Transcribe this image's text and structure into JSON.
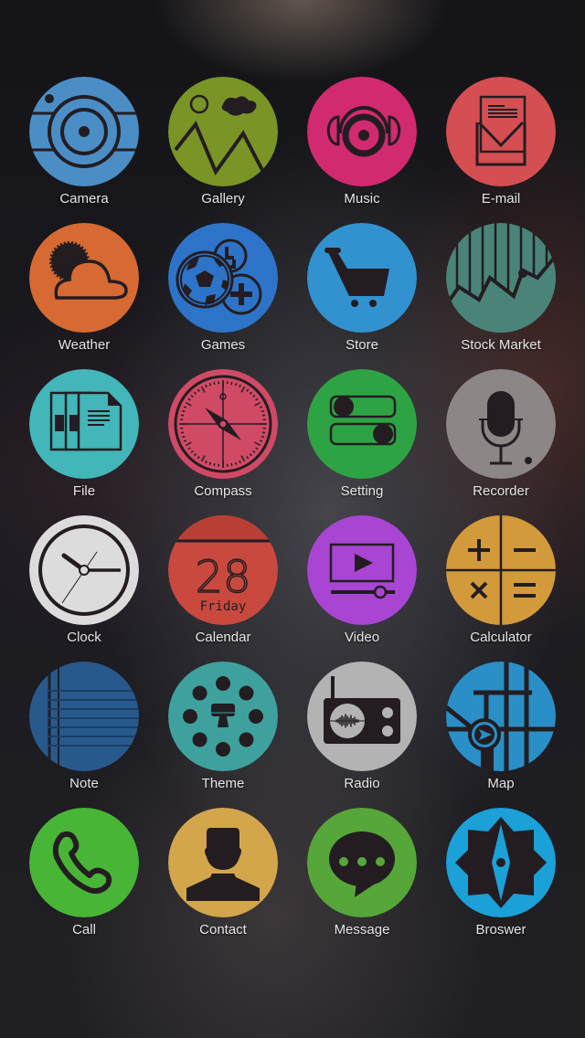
{
  "glyph_color": "#231d22",
  "apps": [
    {
      "label": "Camera",
      "icon": "camera-icon",
      "color": "#4b8ec6"
    },
    {
      "label": "Gallery",
      "icon": "gallery-icon",
      "color": "#7a9426"
    },
    {
      "label": "Music",
      "icon": "music-icon",
      "color": "#d22a6e"
    },
    {
      "label": "E-mail",
      "icon": "email-icon",
      "color": "#d44e52"
    },
    {
      "label": "Weather",
      "icon": "weather-icon",
      "color": "#d66a32"
    },
    {
      "label": "Games",
      "icon": "games-icon",
      "color": "#2d74c8"
    },
    {
      "label": "Store",
      "icon": "store-icon",
      "color": "#3292d0"
    },
    {
      "label": "Stock Market",
      "icon": "stock-market-icon",
      "color": "#4a8478"
    },
    {
      "label": "File",
      "icon": "file-icon",
      "color": "#42b6b8"
    },
    {
      "label": "Compass",
      "icon": "compass-icon",
      "color": "#d04a66"
    },
    {
      "label": "Setting",
      "icon": "setting-icon",
      "color": "#2ea343"
    },
    {
      "label": "Recorder",
      "icon": "recorder-icon",
      "color": "#8c8686"
    },
    {
      "label": "Clock",
      "icon": "clock-icon",
      "color": "#dcdcdc"
    },
    {
      "label": "Calendar",
      "icon": "calendar-icon",
      "color": "#c9493e",
      "day": "28",
      "weekday": "Friday"
    },
    {
      "label": "Video",
      "icon": "video-icon",
      "color": "#a845d2"
    },
    {
      "label": "Calculator",
      "icon": "calculator-icon",
      "color": "#d39a3c"
    },
    {
      "label": "Note",
      "icon": "note-icon",
      "color": "#28598c"
    },
    {
      "label": "Theme",
      "icon": "theme-icon",
      "color": "#3fa19e"
    },
    {
      "label": "Radio",
      "icon": "radio-icon",
      "color": "#b3b3b3"
    },
    {
      "label": "Map",
      "icon": "map-icon",
      "color": "#2a8fc6"
    },
    {
      "label": "Call",
      "icon": "phone-icon",
      "color": "#49b536"
    },
    {
      "label": "Contact",
      "icon": "contact-icon",
      "color": "#d3a64c"
    },
    {
      "label": "Message",
      "icon": "message-icon",
      "color": "#56a63a"
    },
    {
      "label": "Broswer",
      "icon": "browser-icon",
      "color": "#1ba0d8"
    }
  ]
}
